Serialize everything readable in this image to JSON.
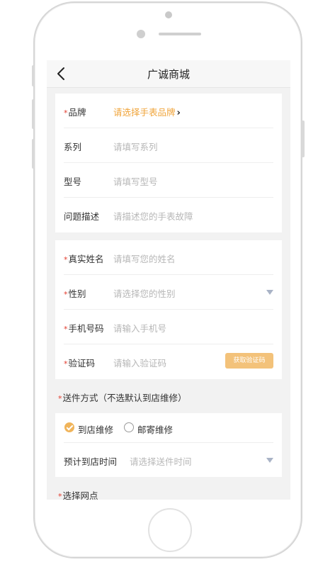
{
  "nav": {
    "title": "广诚商城"
  },
  "watch_info": {
    "brand": {
      "label": "品牌",
      "placeholder": "请选择手表品牌",
      "chevron": "›"
    },
    "series": {
      "label": "系列",
      "placeholder": "请填写系列"
    },
    "model": {
      "label": "型号",
      "placeholder": "请填写型号"
    },
    "issue": {
      "label": "问题描述",
      "placeholder": "请描述您的手表故障"
    }
  },
  "contact": {
    "name": {
      "label": "真实姓名",
      "placeholder": "请填写您的姓名"
    },
    "gender": {
      "label": "性别",
      "placeholder": "请选择您的性别"
    },
    "phone": {
      "label": "手机号码",
      "placeholder": "请输入手机号"
    },
    "code": {
      "label": "验证码",
      "placeholder": "请输入验证码",
      "button": "获取验证码"
    }
  },
  "delivery": {
    "section_label": "送件方式（不选默认到店维修）",
    "options": [
      {
        "label": "到店维修",
        "checked": true
      },
      {
        "label": "邮寄维修",
        "checked": false
      }
    ],
    "time": {
      "label": "预计到店时间",
      "placeholder": "请选择送件时间"
    }
  },
  "store": {
    "section_label": "选择网点"
  },
  "required_mark": "*",
  "colors": {
    "accent": "#f0a43a",
    "button": "#f3c27a",
    "required": "#e23c2e"
  }
}
